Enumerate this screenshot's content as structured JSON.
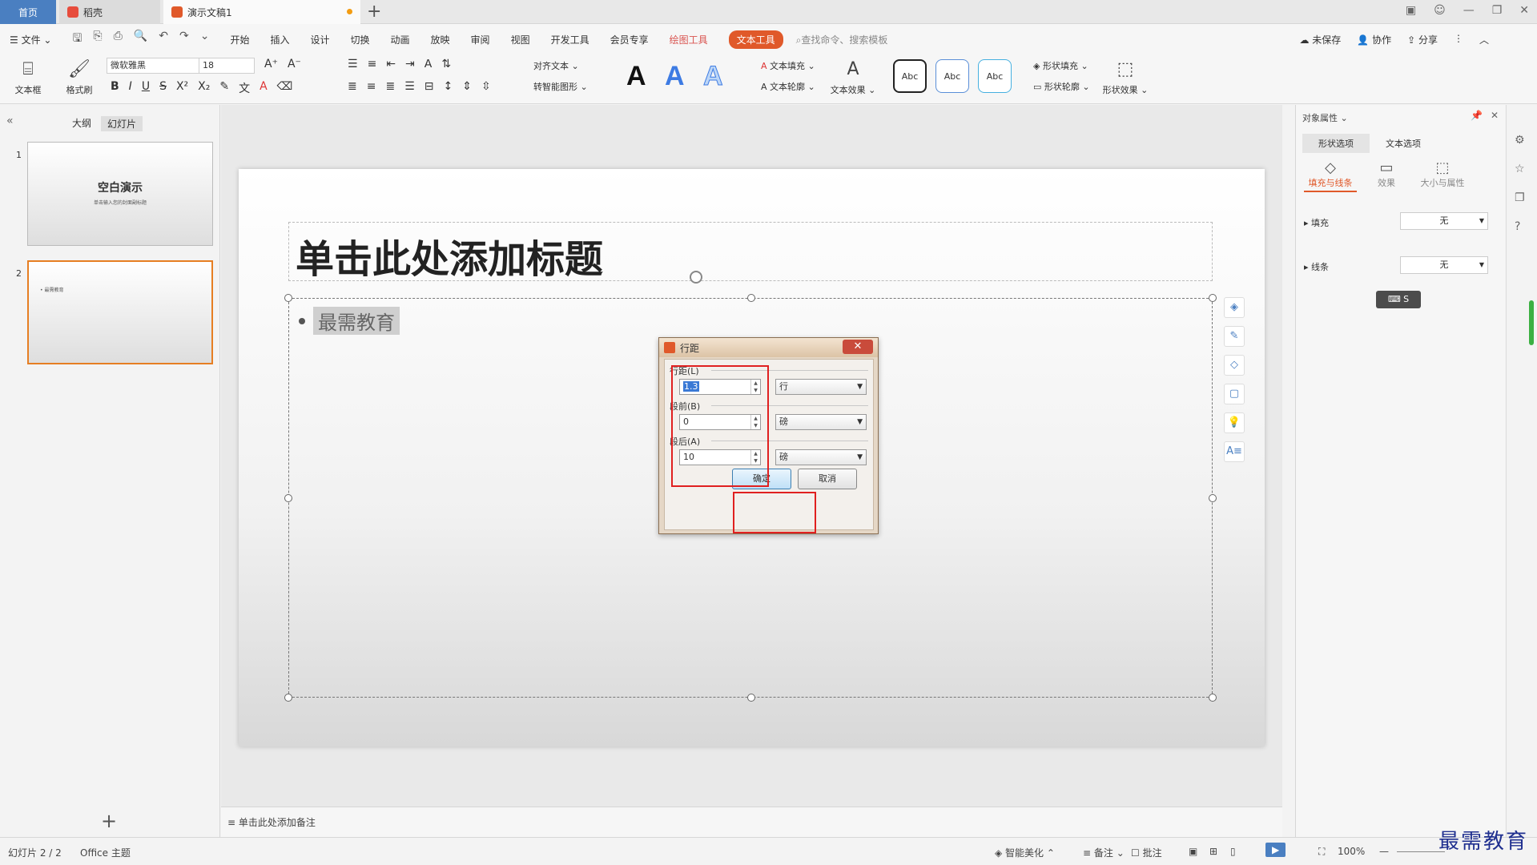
{
  "tabs": {
    "home": "首页",
    "daoke": "稻壳",
    "doc": "演示文稿1",
    "new_tab": "+"
  },
  "menu": {
    "file": "文件",
    "items": [
      "开始",
      "插入",
      "设计",
      "切换",
      "动画",
      "放映",
      "审阅",
      "视图",
      "开发工具",
      "会员专享"
    ],
    "drawing_tools": "绘图工具",
    "text_tools": "文本工具",
    "search_placeholder": "查找命令、搜索模板",
    "unsaved": "未保存",
    "collaborate": "协作",
    "share": "分享"
  },
  "ribbon": {
    "textbox": "文本框",
    "format_painter": "格式刷",
    "font_name": "微软雅黑",
    "font_size": "18",
    "align_text": "对齐文本",
    "smart_shape": "转智能图形",
    "text_fill": "文本填充",
    "text_outline": "文本轮廓",
    "text_effect": "文本效果",
    "style_abc": "Abc",
    "shape_fill": "形状填充",
    "shape_outline": "形状轮廓",
    "shape_effect": "形状效果"
  },
  "left_panel": {
    "outline_tab": "大纲",
    "slides_tab": "幻灯片",
    "slide1_num": "1",
    "slide1_title": "空白演示",
    "slide1_subtitle": "单击输入您的封面副标题",
    "slide2_num": "2",
    "slide2_text": "• 最需教育"
  },
  "slide": {
    "title_placeholder": "单击此处添加标题",
    "bullet_text": "最需教育"
  },
  "notes_placeholder": "单击此处添加备注",
  "dialog": {
    "title": "行距",
    "line_spacing_label": "行距(L)",
    "line_spacing_value": "1.3",
    "line_spacing_unit": "行",
    "before_label": "段前(B)",
    "before_value": "0",
    "before_unit": "磅",
    "after_label": "段后(A)",
    "after_value": "10",
    "after_unit": "磅",
    "ok": "确定",
    "cancel": "取消"
  },
  "right_panel": {
    "header": "对象属性",
    "tab_shape": "形状选项",
    "tab_text": "文本选项",
    "sub_fill_line": "填充与线条",
    "sub_effect": "效果",
    "sub_size": "大小与属性",
    "fill_label": "填充",
    "fill_value": "无",
    "line_label": "线条",
    "line_value": "无"
  },
  "status": {
    "slide_count": "幻灯片 2 / 2",
    "theme": "Office 主题",
    "smart_beautify": "智能美化",
    "notes": "备注",
    "comments": "批注",
    "zoom": "100%"
  },
  "watermark": "最需教育",
  "colors": {
    "accent": "#e0592a",
    "highlight_box": "#e02020",
    "home_tab": "#4a7fc1"
  }
}
